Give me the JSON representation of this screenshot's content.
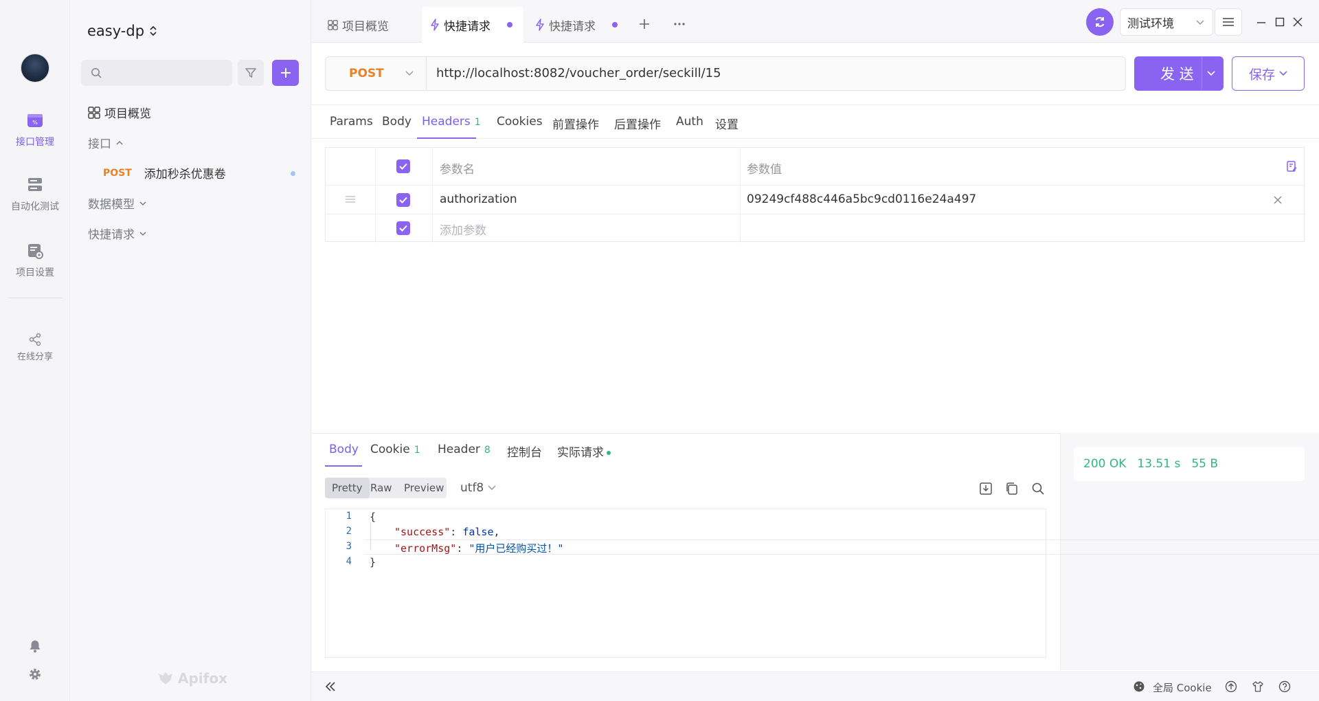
{
  "rail": {
    "items": [
      {
        "label": "接口管理",
        "icon": "api-management-icon",
        "active": true
      },
      {
        "label": "自动化测试",
        "icon": "automation-test-icon",
        "active": false
      },
      {
        "label": "项目设置",
        "icon": "project-settings-icon",
        "active": false
      },
      {
        "label": "在线分享",
        "icon": "share-icon",
        "active": false
      }
    ]
  },
  "sidebar": {
    "project_name": "easy-dp",
    "overview_label": "项目概览",
    "api_group_label": "接口",
    "api_item": {
      "method": "POST",
      "name": "添加秒杀优惠卷"
    },
    "data_model_label": "数据模型",
    "quick_request_label": "快捷请求",
    "brand": "Apifox"
  },
  "tabs": [
    {
      "label": "项目概览",
      "icon": "grid-icon"
    },
    {
      "label": "快捷请求",
      "icon": "lightning-icon",
      "active": true
    },
    {
      "label": "快捷请求",
      "icon": "lightning-icon"
    }
  ],
  "env": {
    "name": "测试环境"
  },
  "request": {
    "method": "POST",
    "url": "http://localhost:8082/voucher_order/seckill/15",
    "send_label": "发 送",
    "save_label": "保存"
  },
  "req_tabs": {
    "params": "Params",
    "body": "Body",
    "headers": "Headers",
    "headers_count": "1",
    "cookies": "Cookies",
    "pre": "前置操作",
    "post": "后置操作",
    "auth": "Auth",
    "settings": "设置"
  },
  "params_table": {
    "col_name": "参数名",
    "col_value": "参数值",
    "rows": [
      {
        "name": "authorization",
        "value": "09249cf488c446a5bc9cd0116e24a497"
      }
    ],
    "add_placeholder": "添加参数"
  },
  "response": {
    "tabs": {
      "body": "Body",
      "cookie": "Cookie",
      "cookie_count": "1",
      "header": "Header",
      "header_count": "8",
      "console": "控制台",
      "actual": "实际请求"
    },
    "formats": {
      "pretty": "Pretty",
      "raw": "Raw",
      "preview": "Preview"
    },
    "encoding": "utf8",
    "status": "200 OK",
    "time": "13.51 s",
    "size": "55 B",
    "code_lines": [
      {
        "n": "1",
        "text": "{"
      },
      {
        "n": "2",
        "key": "\"success\"",
        "sep": ": ",
        "val": "false",
        "tail": ","
      },
      {
        "n": "3",
        "key": "\"errorMsg\"",
        "sep": ": ",
        "val": "\"用户已经购买过！\""
      },
      {
        "n": "4",
        "text": "}"
      }
    ]
  },
  "bottom": {
    "cookie_label": "全局 Cookie"
  },
  "colors": {
    "accent": "#8a64f0",
    "post": "#e8822a",
    "success": "#33b583"
  }
}
